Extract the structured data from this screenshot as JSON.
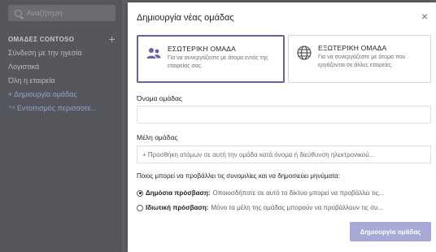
{
  "background": {
    "search_placeholder": "Αναζήτηση",
    "section_header": "ΟΜΑΔΕΣ CONTOSO",
    "section_add": "+",
    "items": [
      {
        "label": "Σύνδεση με την ηγεσία"
      },
      {
        "label": "Λογιστικά"
      },
      {
        "label": "Όλη η εταιρεία"
      },
      {
        "label": "+ Δημιουργία ομάδας"
      },
      {
        "label": "⁺⁸ Εντοπισμός περισσοτε..."
      }
    ]
  },
  "dialog": {
    "title": "Δημιουργία νέας ομάδας",
    "close": "×",
    "options": [
      {
        "title": "ΕΣΩΤΕΡΙΚΗ ΟΜΑΔΑ",
        "desc": "Για να συνεργάζεστε με άτομα εντός της εταιρείας σας.",
        "icon": "people-icon",
        "selected": true
      },
      {
        "title": "ΕΞΩΤΕΡΙΚΗ ΟΜΑΔΑ",
        "desc": "Για να συνεργάζεστε με άτομα που εργάζονται σε άλλες εταιρείες.",
        "icon": "globe-icon",
        "selected": false
      }
    ],
    "team_name_label": "Όνομα ομάδας",
    "team_name_value": "",
    "members_label": "Μέλη ομάδας",
    "members_placeholder": "+ Προσθήκη ατόμων σε αυτή την ομάδα κατά όνομα ή διεύθυνση ηλεκτρονικού...",
    "who_question": "Ποιος μπορεί να προβάλλει τις συνομιλίες και να δημοσιεύει μηνύματα:",
    "access": [
      {
        "label": "Δημόσια πρόσβαση:",
        "desc": "Οποιοσδήποτε σε αυτό το δίκτυο μπορεί να προβάλλει τις...",
        "checked": true
      },
      {
        "label": "Ιδιωτική πρόσβαση:",
        "desc": "Μόνο τα μέλη της ομάδας μπορούν να προβάλλουν τις συ...",
        "checked": false
      }
    ],
    "create_button": "Δημιουργία ομάδας"
  },
  "colors": {
    "accent": "#6264a7",
    "button_disabled": "#a7a9d6"
  }
}
